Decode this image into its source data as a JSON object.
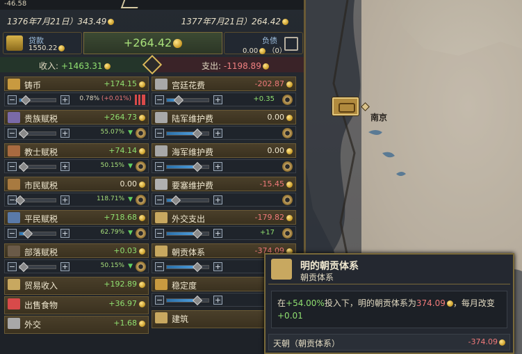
{
  "top": {
    "snippet": "-46.58"
  },
  "dates": {
    "left": "1376年7月21日）343.49",
    "right": "1377年7月21日）264.42"
  },
  "loan": {
    "label": "贷款",
    "value": "1550.22"
  },
  "balance": {
    "value": "+264.42"
  },
  "debt": {
    "label": "负债",
    "value": "0.00",
    "count": "（0）"
  },
  "income": {
    "label": "收入:",
    "value": "+1463.31"
  },
  "expense": {
    "label": "支出:",
    "value": "-1198.89"
  },
  "income_rows": [
    {
      "name": "铸币",
      "value": "+174.15",
      "sign": "pos",
      "pct": "0.78%",
      "pct_extra": "(+0.01%)",
      "slider": 0.15
    },
    {
      "name": "贵族赋税",
      "value": "+264.73",
      "sign": "pos",
      "pct": "55.07%",
      "slider": 0.1
    },
    {
      "name": "教士赋税",
      "value": "+74.14",
      "sign": "pos",
      "pct": "50.15%",
      "slider": 0.1
    },
    {
      "name": "市民赋税",
      "value": "0.00",
      "sign": "zero",
      "pct": "118.71%",
      "slider": 0.0
    },
    {
      "name": "平民赋税",
      "value": "+718.68",
      "sign": "pos",
      "pct": "62.79%",
      "slider": 0.2
    },
    {
      "name": "部落赋税",
      "value": "+0.03",
      "sign": "pos",
      "pct": "50.15%",
      "slider": 0.1
    }
  ],
  "income_simple": [
    {
      "name": "贸易收入",
      "value": "+192.89"
    },
    {
      "name": "出售食物",
      "value": "+36.97"
    },
    {
      "name": "外交",
      "value": "+1.68"
    }
  ],
  "expense_rows": [
    {
      "name": "宫廷花费",
      "value": "-202.87",
      "sign": "neg",
      "extra": "+0.35",
      "slider": 0.25
    },
    {
      "name": "陆军维护费",
      "value": "0.00",
      "sign": "zero",
      "slider": 0.7
    },
    {
      "name": "海军维护费",
      "value": "0.00",
      "sign": "zero",
      "slider": 0.7
    },
    {
      "name": "要塞维护费",
      "value": "-15.45",
      "sign": "neg",
      "slider": 0.2
    },
    {
      "name": "外交支出",
      "value": "-179.82",
      "sign": "neg",
      "extra": "+17",
      "slider": 0.7
    },
    {
      "name": "朝贡体系",
      "value": "-374.09",
      "sign": "neg",
      "slider": 0.7
    },
    {
      "name": "稳定度",
      "value": "",
      "sign": "neg",
      "slider": 0.7
    }
  ],
  "expense_simple": [
    {
      "name": "建筑",
      "value": ""
    }
  ],
  "map": {
    "city": "南京"
  },
  "tooltip": {
    "title": "明的朝贡体系",
    "subtitle": "朝贡体系",
    "body_prefix": "在",
    "body_pct": "+54.00%",
    "body_mid": "投入下，明的朝贡体系为",
    "body_value": "374.09",
    "body_suffix": "，每月改变",
    "body_change": "+0.01",
    "footer_label": "天朝（朝贡体系）",
    "footer_value": "-374.09"
  },
  "colors": {
    "positive": "#90e070",
    "negative": "#f07a7a",
    "gold": "#c89a26",
    "slider": "#4fa0e0"
  },
  "icons": [
    "coin-icon",
    "loan-icon",
    "debt-icon",
    "gear-icon",
    "tribute-icon",
    "city-icon"
  ]
}
